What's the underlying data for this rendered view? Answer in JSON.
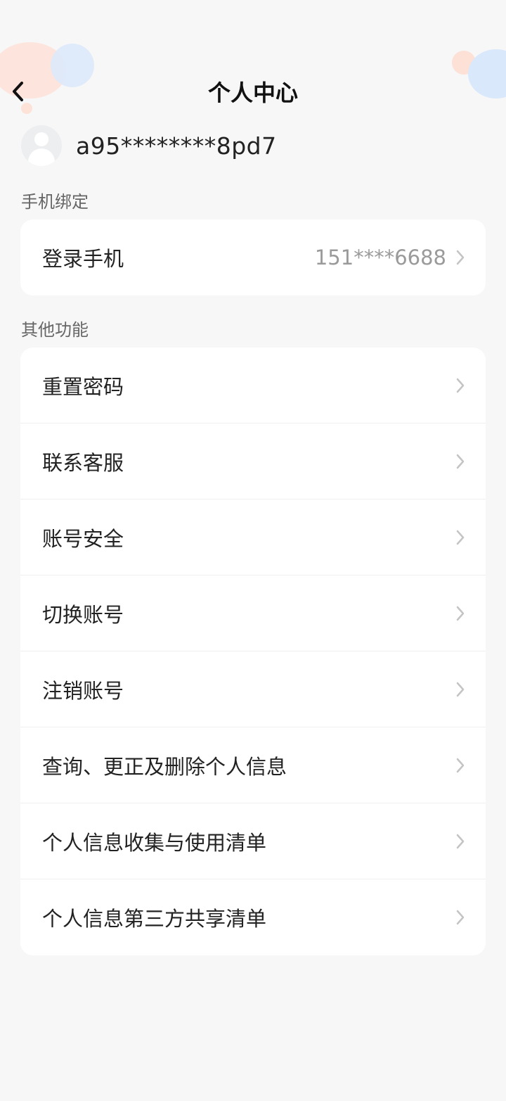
{
  "header": {
    "title": "个人中心"
  },
  "profile": {
    "username": "a95********8pd7"
  },
  "phone_section": {
    "label": "手机绑定",
    "items": [
      {
        "label": "登录手机",
        "value": "151****6688"
      }
    ]
  },
  "other_section": {
    "label": "其他功能",
    "items": [
      {
        "label": "重置密码"
      },
      {
        "label": "联系客服"
      },
      {
        "label": "账号安全"
      },
      {
        "label": "切换账号"
      },
      {
        "label": "注销账号"
      },
      {
        "label": "查询、更正及删除个人信息"
      },
      {
        "label": "个人信息收集与使用清单"
      },
      {
        "label": "个人信息第三方共享清单"
      }
    ]
  },
  "icons": {
    "back": "back-arrow-icon",
    "chevron": "chevron-right-icon",
    "avatar": "default-avatar-icon"
  }
}
